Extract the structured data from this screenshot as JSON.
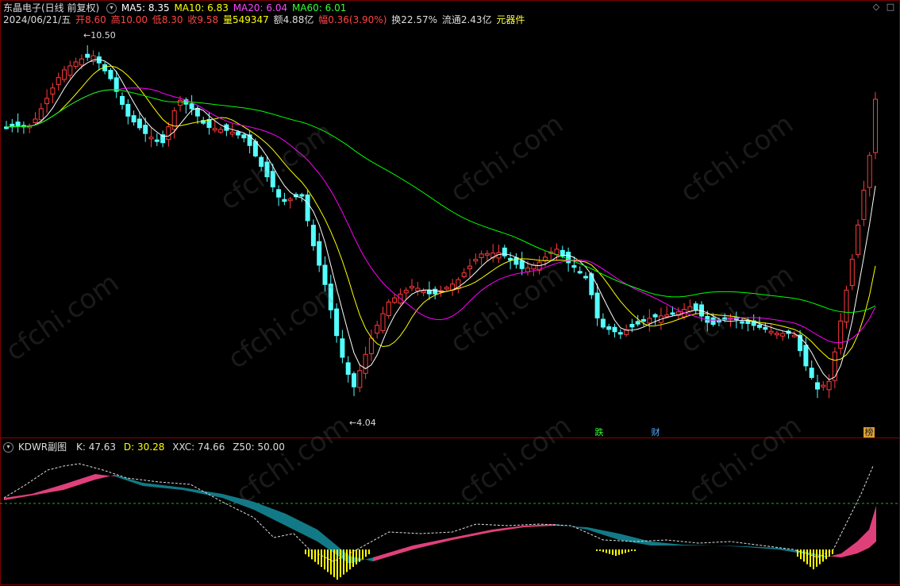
{
  "header": {
    "stock_name": "东晶电子(日线 前复权)",
    "ma5_label": "MA5: 8.35",
    "ma10_label": "MA10: 6.83",
    "ma20_label": "MA20: 6.04",
    "ma60_label": "MA60: 6.01",
    "date": "2024/06/21/五",
    "open_label": "开",
    "open_value": "8.60",
    "high_label": "高",
    "high_value": "10.00",
    "low_label": "低",
    "low_value": "8.30",
    "close_label": "收",
    "close_value": "9.58",
    "volume_label": "量",
    "volume_value": "549347",
    "amount_label": "额",
    "amount_value": "4.88亿",
    "change_label": "幅",
    "change_value": "0.36(3.90%)",
    "turnover_label": "换",
    "turnover_value": "22.57%",
    "float_label": "流通",
    "float_value": "2.43亿",
    "sector": "元器件"
  },
  "annotations": {
    "high_marker": "10.50",
    "low_marker": "4.04",
    "event_die": "跌",
    "event_cai": "财",
    "event_bang": "榜"
  },
  "sub_header": {
    "indicator_name": "KDWR副图",
    "k_label": "K: 47.63",
    "d_label": "D: 30.28",
    "xxc_label": "XXC: 74.66",
    "z50_label": "Z50: 50.00"
  },
  "watermark": "cfchi.com",
  "colors": {
    "up": "#ff3b3b",
    "down": "#54ffff",
    "ma5": "#ffffff",
    "ma10": "#ffff00",
    "ma20": "#ff00ff",
    "ma60": "#00ff00",
    "k_fill_up": "#e0407a",
    "k_fill_down": "#127a86",
    "bar_yellow": "#ffff00"
  }
}
